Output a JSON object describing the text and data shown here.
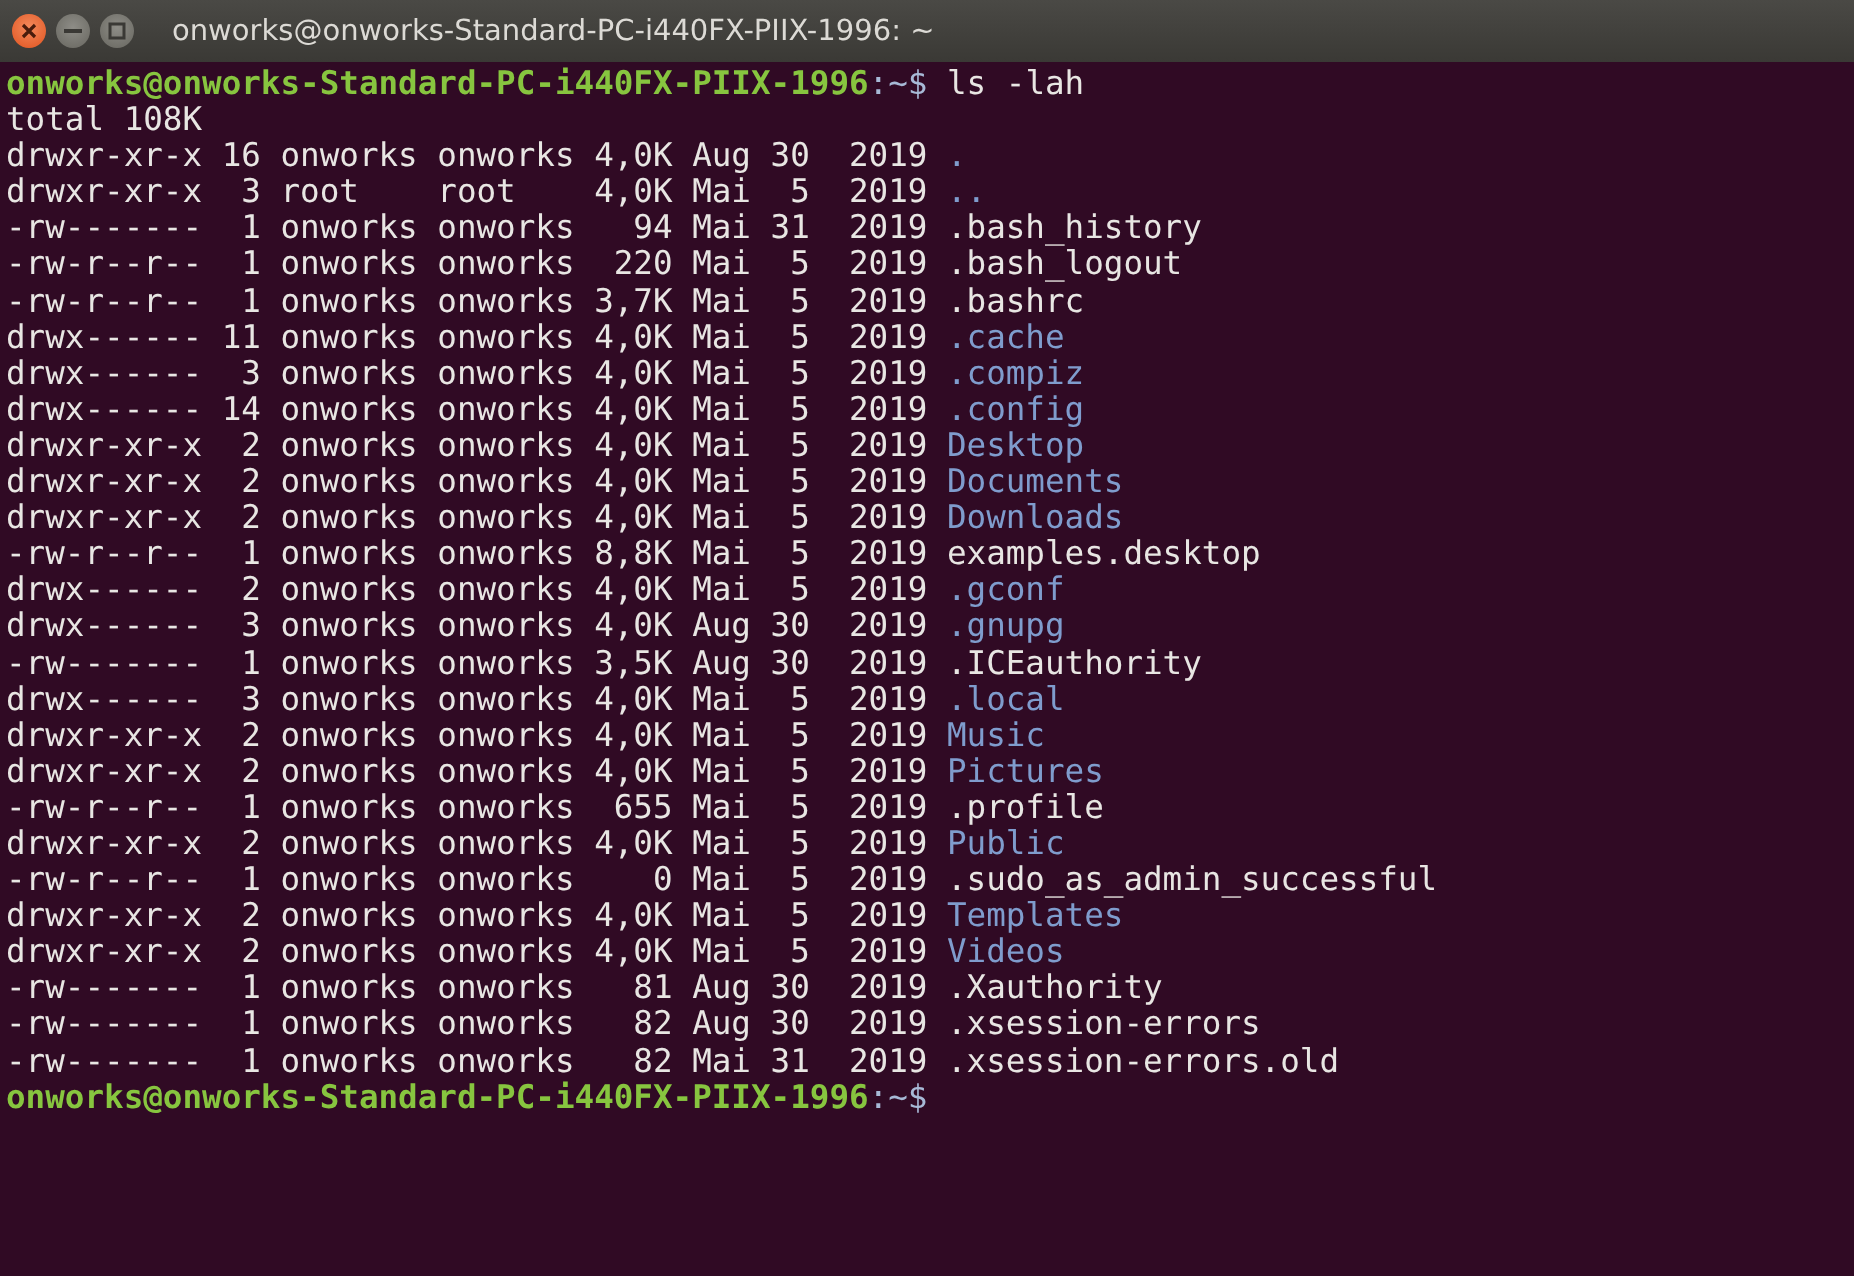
{
  "window": {
    "title": "onworks@onworks-Standard-PC-i440FX-PIIX-1996: ~"
  },
  "lines": [
    {
      "kind": "prompt",
      "user_host": "onworks@onworks-Standard-PC-i440FX-PIIX-1996",
      "path": ":~$",
      "command": "ls -lah"
    },
    {
      "kind": "output",
      "text": "total 108K"
    },
    {
      "kind": "dir",
      "meta": "drwxr-xr-x 16 onworks onworks 4,0K Aug 30  2019",
      "name": "."
    },
    {
      "kind": "dir",
      "meta": "drwxr-xr-x  3 root    root    4,0K Mai  5  2019",
      "name": ".."
    },
    {
      "kind": "file",
      "meta": "-rw-------  1 onworks onworks   94 Mai 31  2019",
      "name": ".bash_history"
    },
    {
      "kind": "file",
      "meta": "-rw-r--r--  1 onworks onworks  220 Mai  5  2019",
      "name": ".bash_logout"
    },
    {
      "kind": "file",
      "meta": "-rw-r--r--  1 onworks onworks 3,7K Mai  5  2019",
      "name": ".bashrc"
    },
    {
      "kind": "dir",
      "meta": "drwx------ 11 onworks onworks 4,0K Mai  5  2019",
      "name": ".cache"
    },
    {
      "kind": "dir",
      "meta": "drwx------  3 onworks onworks 4,0K Mai  5  2019",
      "name": ".compiz"
    },
    {
      "kind": "dir",
      "meta": "drwx------ 14 onworks onworks 4,0K Mai  5  2019",
      "name": ".config"
    },
    {
      "kind": "dir",
      "meta": "drwxr-xr-x  2 onworks onworks 4,0K Mai  5  2019",
      "name": "Desktop"
    },
    {
      "kind": "dir",
      "meta": "drwxr-xr-x  2 onworks onworks 4,0K Mai  5  2019",
      "name": "Documents"
    },
    {
      "kind": "dir",
      "meta": "drwxr-xr-x  2 onworks onworks 4,0K Mai  5  2019",
      "name": "Downloads"
    },
    {
      "kind": "file",
      "meta": "-rw-r--r--  1 onworks onworks 8,8K Mai  5  2019",
      "name": "examples.desktop"
    },
    {
      "kind": "dir",
      "meta": "drwx------  2 onworks onworks 4,0K Mai  5  2019",
      "name": ".gconf"
    },
    {
      "kind": "dir",
      "meta": "drwx------  3 onworks onworks 4,0K Aug 30  2019",
      "name": ".gnupg"
    },
    {
      "kind": "file",
      "meta": "-rw-------  1 onworks onworks 3,5K Aug 30  2019",
      "name": ".ICEauthority"
    },
    {
      "kind": "dir",
      "meta": "drwx------  3 onworks onworks 4,0K Mai  5  2019",
      "name": ".local"
    },
    {
      "kind": "dir",
      "meta": "drwxr-xr-x  2 onworks onworks 4,0K Mai  5  2019",
      "name": "Music"
    },
    {
      "kind": "dir",
      "meta": "drwxr-xr-x  2 onworks onworks 4,0K Mai  5  2019",
      "name": "Pictures"
    },
    {
      "kind": "file",
      "meta": "-rw-r--r--  1 onworks onworks  655 Mai  5  2019",
      "name": ".profile"
    },
    {
      "kind": "dir",
      "meta": "drwxr-xr-x  2 onworks onworks 4,0K Mai  5  2019",
      "name": "Public"
    },
    {
      "kind": "file",
      "meta": "-rw-r--r--  1 onworks onworks    0 Mai  5  2019",
      "name": ".sudo_as_admin_successful"
    },
    {
      "kind": "dir",
      "meta": "drwxr-xr-x  2 onworks onworks 4,0K Mai  5  2019",
      "name": "Templates"
    },
    {
      "kind": "dir",
      "meta": "drwxr-xr-x  2 onworks onworks 4,0K Mai  5  2019",
      "name": "Videos"
    },
    {
      "kind": "file",
      "meta": "-rw-------  1 onworks onworks   81 Aug 30  2019",
      "name": ".Xauthority"
    },
    {
      "kind": "file",
      "meta": "-rw-------  1 onworks onworks   82 Aug 30  2019",
      "name": ".xsession-errors"
    },
    {
      "kind": "file",
      "meta": "-rw-------  1 onworks onworks   82 Mai 31  2019",
      "name": ".xsession-errors.old"
    },
    {
      "kind": "prompt",
      "user_host": "onworks@onworks-Standard-PC-i440FX-PIIX-1996",
      "path": ":~$"
    }
  ]
}
